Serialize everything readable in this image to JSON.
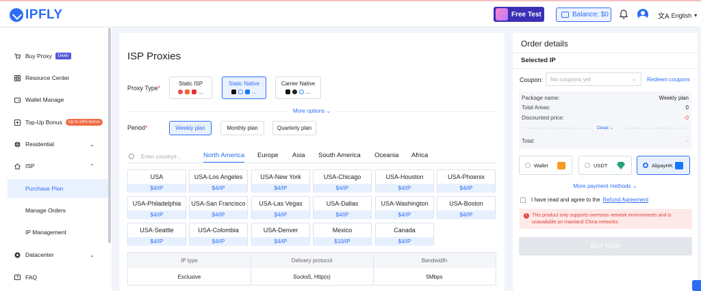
{
  "brand": {
    "name": "IPFLY"
  },
  "header": {
    "free_test": "Free Test",
    "balance": "Balance: $0",
    "language": "English"
  },
  "sidebar": {
    "items": [
      {
        "label": "Buy Proxy",
        "badge": "Deals"
      },
      {
        "label": "Resource Center"
      },
      {
        "label": "Wallet Manage"
      },
      {
        "label": "Top-Up Bonus",
        "badge": "Up to 24% bonus"
      },
      {
        "label": "Residential"
      },
      {
        "label": "ISP"
      },
      {
        "label": "Purchase Plan"
      },
      {
        "label": "Manage Orders"
      },
      {
        "label": "IP Management"
      },
      {
        "label": "Datacenter"
      },
      {
        "label": "FAQ"
      }
    ]
  },
  "main": {
    "title": "ISP Proxies",
    "proxy_type_label": "Proxy Type",
    "proxy_types": [
      {
        "label": "Static ISP",
        "more": "..."
      },
      {
        "label": "Static Native",
        "more": "..."
      },
      {
        "label": "Carrier Native",
        "more": "..."
      }
    ],
    "more_options": "More options",
    "period_label": "Period",
    "periods": [
      "Weekly plan",
      "Monthly plan",
      "Quarterly plan"
    ],
    "search_placeholder": "Enter country/r...",
    "regions": [
      "North America",
      "Europe",
      "Asia",
      "South America",
      "Oceania",
      "Africa"
    ],
    "cities": [
      {
        "name": "USA",
        "price": "$4/IP"
      },
      {
        "name": "USA-Los Angeles",
        "price": "$4/IP"
      },
      {
        "name": "USA-New York",
        "price": "$4/IP"
      },
      {
        "name": "USA-Chicago",
        "price": "$4/IP"
      },
      {
        "name": "USA-Houston",
        "price": "$4/IP"
      },
      {
        "name": "USA-Phoenix",
        "price": "$4/IP"
      },
      {
        "name": "USA-Philadelphia",
        "price": "$4/IP"
      },
      {
        "name": "USA-San Francisco",
        "price": "$4/IP"
      },
      {
        "name": "USA-Las Vegas",
        "price": "$4/IP"
      },
      {
        "name": "USA-Dallas",
        "price": "$4/IP"
      },
      {
        "name": "USA-Washington",
        "price": "$4/IP"
      },
      {
        "name": "USA-Boston",
        "price": "$4/IP"
      },
      {
        "name": "USA-Seattle",
        "price": "$4/IP"
      },
      {
        "name": "USA-Colombia",
        "price": "$4/IP"
      },
      {
        "name": "USA-Denver",
        "price": "$4/IP"
      },
      {
        "name": "Mexico",
        "price": "$10/IP"
      },
      {
        "name": "Canada",
        "price": "$4/IP"
      }
    ],
    "spec_headers": [
      "IP type",
      "Delivery protocol",
      "Bandwidth"
    ],
    "spec_values": [
      "Exclusive",
      "Socks5, Http(s)",
      "5Mbps"
    ]
  },
  "order": {
    "title": "Order details",
    "selected_ip": "Selected IP",
    "coupon_label": "Coupon:",
    "coupon_placeholder": "No coupons yet",
    "redeem": "Redeem coupons",
    "package_label": "Package name:",
    "package_value": "Weekly plan",
    "areas_label": "Total Areas:",
    "areas_value": "0",
    "discount_label": "Discounted price:",
    "discount_value": "-0",
    "detail": "Detail",
    "total_label": "Total:",
    "total_value": "-",
    "payments": [
      "Wallet",
      "USDT",
      "AlipayHK"
    ],
    "more_payment": "More payment methods",
    "agree_text": "I have read and agree to the",
    "agree_link": "Refund Agreement",
    "warning": "This product only supports overseas network environments and is unavailable on mainland China networks",
    "buy": "BUY NOW"
  },
  "colors": {
    "accent": "#2c6df5",
    "warning": "#e0413b"
  }
}
